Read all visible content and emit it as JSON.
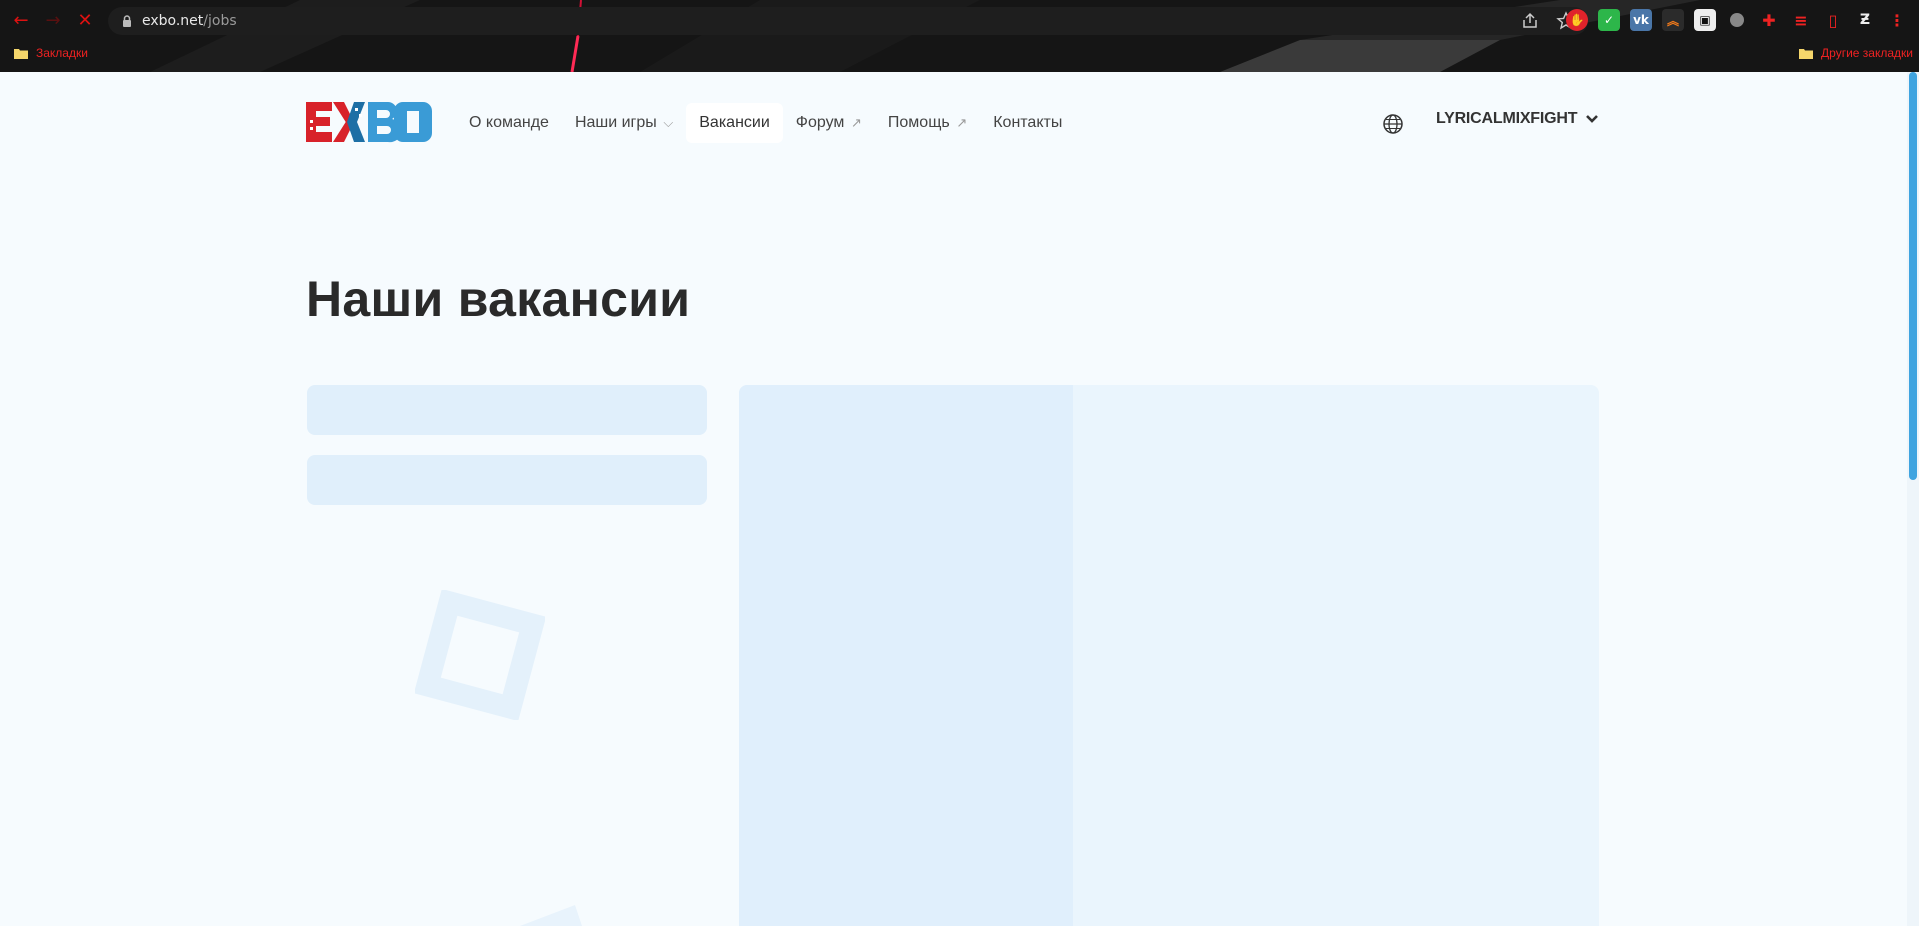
{
  "browser": {
    "url_host": "exbo.net",
    "url_path": "/jobs",
    "bookmarks_label": "Закладки",
    "other_bookmarks_label": "Другие закладки",
    "accent_color": "#dd1111"
  },
  "header": {
    "nav": {
      "about": "О команде",
      "games": "Наши игры",
      "jobs": "Вакансии",
      "forum": "Форум",
      "help": "Помощь",
      "contacts": "Контакты"
    },
    "username": "LYRICALMIXFIGHT"
  },
  "main": {
    "title": "Наши вакансии"
  },
  "colors": {
    "page_bg": "#f6fbfe",
    "skeleton": "#e0effb",
    "panel": "#eaf5fd",
    "logo_red": "#d8222a",
    "logo_blue": "#3a9bd6"
  }
}
